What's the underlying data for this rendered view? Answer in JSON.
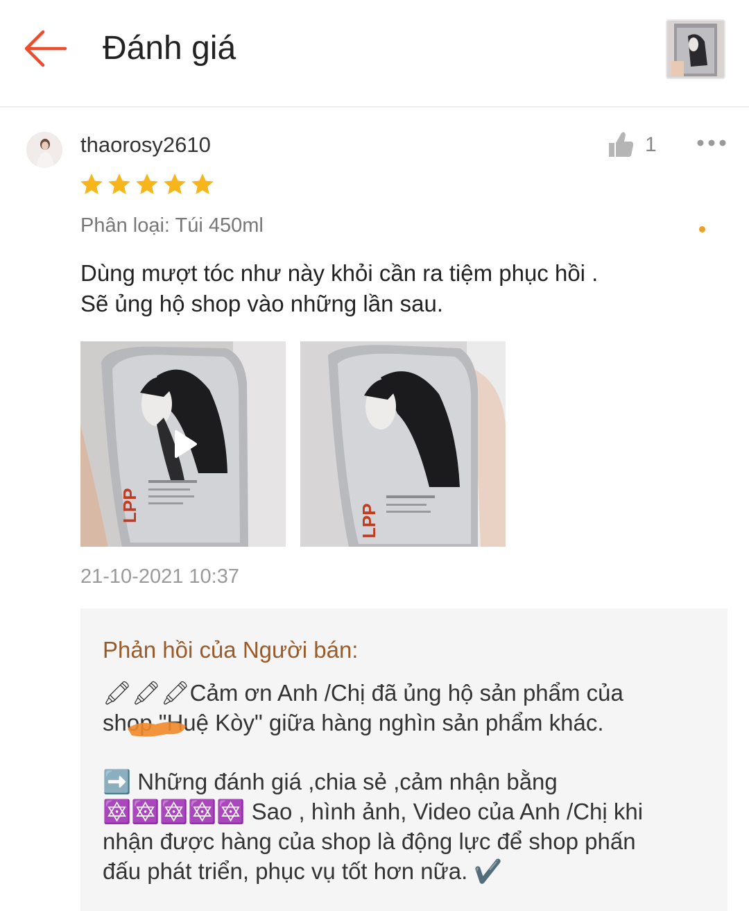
{
  "header": {
    "title": "Đánh giá",
    "back_icon": "arrow-left-icon",
    "accent": "#ee4d2d"
  },
  "review": {
    "username": "thaorosy2610",
    "rating": 5,
    "star_color": "#f7b51d",
    "like_count": "1",
    "variation": "Phân loại: Túi 450ml",
    "text": "Dùng mượt tóc như này khỏi cần ra tiệm phục hồi .\nSẽ ủng hộ shop vào những lần sau.",
    "media": [
      {
        "type": "video",
        "icon": "play-icon",
        "packaging_text": "LPP"
      },
      {
        "type": "image",
        "packaging_text": "LPP"
      }
    ],
    "timestamp": "21-10-2021 10:37"
  },
  "seller_reply": {
    "title": "Phản hồi của Người bán:",
    "paragraph1": "🖍🖍🖍Cảm ơn Anh /Chị đã ủng hộ sản phẩm của\nshop     \"Huệ Kòy\"  giữa hàng nghìn sản phẩm khác.",
    "paragraph2": "➡️ Những đánh giá ,chia sẻ ,cảm nhận bằng\n🔯🔯🔯🔯🔯 Sao , hình ảnh, Video của Anh /Chị khi\nnhận được hàng của shop là động lực để shop phấn\nđấu phát triển, phục vụ tốt hơn nữa. ✔️",
    "title_color": "#9a5b2a",
    "background": "#f5f5f5"
  }
}
